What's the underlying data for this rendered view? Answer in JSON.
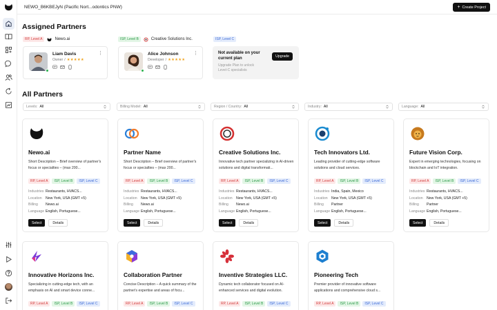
{
  "topbar": {
    "workspace": "NEWO_B6KBEJyN (Pacific Nort...odontics PNW)",
    "create_project": "Create Project"
  },
  "sidebar": {
    "items": [
      {
        "icon": "home-icon",
        "active": true
      },
      {
        "icon": "book-icon"
      },
      {
        "icon": "grid-icon"
      },
      {
        "icon": "chat-icon"
      },
      {
        "icon": "users-icon"
      },
      {
        "icon": "refresh-icon"
      },
      {
        "icon": "analytics-icon"
      }
    ],
    "bottom_items": [
      {
        "icon": "sliders-icon"
      },
      {
        "icon": "play-icon"
      },
      {
        "icon": "help-icon"
      },
      {
        "icon": "avatar"
      },
      {
        "icon": "logout-icon"
      }
    ]
  },
  "assigned": {
    "title": "Assigned Partners",
    "groups": [
      {
        "level": "RP, Level A",
        "partner": "Newo.ai"
      },
      {
        "level": "ISP, Level B",
        "partner": "Creative Solutions Inc."
      },
      {
        "level": "ISP, Level C"
      }
    ],
    "people": [
      {
        "name": "Liam Davis",
        "role": "Owner",
        "separator": "/",
        "stars": "★★★★★"
      },
      {
        "name": "Alice Johnson",
        "role": "Developer",
        "separator": "/",
        "stars": "★★★★★"
      }
    ],
    "upgrade": {
      "title": "Not available on your current plan",
      "subtitle": "Upgrade Plan to unlock Level-C specialists",
      "button": "Upgrade"
    }
  },
  "all_partners": {
    "title": "All Partners",
    "filters": [
      {
        "label": "Levels:",
        "value": "All"
      },
      {
        "label": "Billing Model:",
        "value": "All"
      },
      {
        "label": "Region / Country:",
        "value": "All"
      },
      {
        "label": "Industry:",
        "value": "All"
      },
      {
        "label": "Language:",
        "value": "All"
      }
    ],
    "badges": {
      "rp": "RP, Level A",
      "ispb": "ISP, Level B",
      "ispc": "ISP, Level C"
    },
    "detail_labels": {
      "industries": "Industries",
      "location": "Location",
      "billing": "Billing",
      "language": "Language"
    },
    "select_label": "Select",
    "details_label": "Details",
    "cards": [
      {
        "name": "Newo.ai",
        "desc": "Short Description – Brief overview of partner's focus or specialties – (max 200...",
        "industries": "Restaurants, HVACS...",
        "location": "New York, USA (GMT +5)",
        "billing": "Newo.ai",
        "language": "English, Portuguese..."
      },
      {
        "name": "Partner Name",
        "desc": "Short Description – Brief overview of partner's focus or specialties – (max 200...",
        "industries": "Restaurants, HVACS...",
        "location": "New York, USA (GMT +5)",
        "billing": "Newo.ai",
        "language": "English, Portuguese..."
      },
      {
        "name": "Creative Solutions Inc.",
        "desc": "Innovative tech partner specializing in AI-driven solutions and digital transformati...",
        "industries": "Restaurants, HVACS...",
        "location": "New York, USA (GMT +5)",
        "billing": "Newo.ai",
        "language": "English, Portuguese..."
      },
      {
        "name": "Tech Innovators Ltd.",
        "desc": "Leading provider of cutting-edge software solutions and cloud services.",
        "industries": "India, Spain, Mexico",
        "location": "New York, USA (GMT +5)",
        "billing": "Partner",
        "language": "English, Portuguese..."
      },
      {
        "name": "Future Vision Corp.",
        "desc": "Expert in emerging technologies, focusing on blockchain and IoT integration.",
        "industries": "Restaurants, HVACS...",
        "location": "New York, USA (GMT +5)",
        "billing": "Partner",
        "language": "English, Portuguese..."
      },
      {
        "name": "Innovative Horizons Inc.",
        "desc": "Specializing in cutting-edge tech, with an emphasis on AI and smart device conne..."
      },
      {
        "name": "Collaboration Partner",
        "desc": "Concise Description – A quick summary of the partner's expertise and areas of focu..."
      },
      {
        "name": "Inventive Strategies LLC.",
        "desc": "Dynamic tech collaborator focused on AI-enhanced services and digital evolution."
      },
      {
        "name": "Pioneering Tech",
        "desc": "Premier provider of innovative software applications and comprehensive cloud s..."
      }
    ]
  },
  "colors": {
    "accent": "#111111",
    "online": "#2ab24e",
    "star": "#f0a21a",
    "rp": "#d23c3c",
    "isp_b": "#2d9a4a",
    "isp_c": "#3c6ad6"
  }
}
